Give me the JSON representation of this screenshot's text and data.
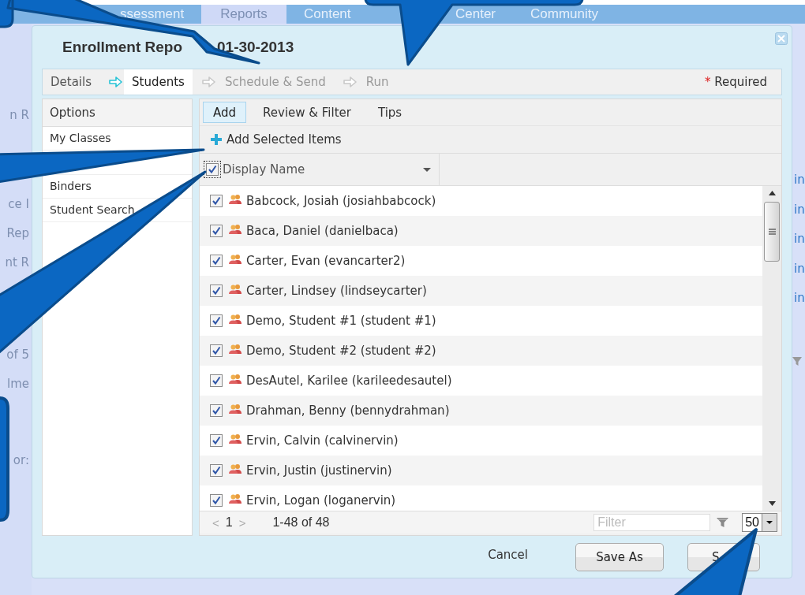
{
  "background": {
    "nav_tabs": [
      {
        "label": "ssessment",
        "selected": false
      },
      {
        "label": "Reports",
        "selected": true
      },
      {
        "label": "Content",
        "selected": false
      },
      {
        "label": "Center",
        "selected": false
      },
      {
        "label": "Community",
        "selected": false
      }
    ],
    "left_fragments": [
      "n R",
      "ce I",
      "Rep",
      "nt R",
      "of 5",
      "lme",
      "or:"
    ],
    "right_fragments": [
      "in",
      "in",
      "in",
      "in",
      "in"
    ]
  },
  "dialog": {
    "title_start": "Enrollment Repo",
    "title_end": "01-30-2013",
    "steps": [
      {
        "label": "Details",
        "selected": false,
        "disabled": false
      },
      {
        "label": "Students",
        "selected": true,
        "disabled": false
      },
      {
        "label": "Schedule & Send",
        "selected": false,
        "disabled": true
      },
      {
        "label": "Run",
        "selected": false,
        "disabled": true
      }
    ],
    "required_mark": "*",
    "required_note": "Required",
    "options": {
      "header": "Options",
      "items": [
        {
          "label": "My Classes"
        },
        {
          "label": "Binders"
        },
        {
          "label": "Student Search"
        }
      ]
    },
    "subtabs": [
      {
        "label": "Add",
        "selected": true
      },
      {
        "label": "Review & Filter",
        "selected": false
      },
      {
        "label": "Tips",
        "selected": false
      }
    ],
    "add_selected": "Add Selected Items",
    "column": {
      "label": "Display Name",
      "checked": true
    },
    "students": [
      {
        "name": "Babcock, Josiah (josiahbabcock)",
        "checked": true
      },
      {
        "name": "Baca, Daniel (danielbaca)",
        "checked": true
      },
      {
        "name": "Carter, Evan (evancarter2)",
        "checked": true
      },
      {
        "name": "Carter, Lindsey (lindseycarter)",
        "checked": true
      },
      {
        "name": "Demo, Student #1 (student #1)",
        "checked": true
      },
      {
        "name": "Demo, Student #2 (student #2)",
        "checked": true
      },
      {
        "name": "DesAutel, Karilee (karileedesautel)",
        "checked": true
      },
      {
        "name": "Drahman, Benny (bennydrahman)",
        "checked": true
      },
      {
        "name": "Ervin, Calvin (calvinervin)",
        "checked": true
      },
      {
        "name": "Ervin, Justin (justinervin)",
        "checked": true
      },
      {
        "name": "Ervin, Logan (loganervin)",
        "checked": true
      }
    ],
    "pager": {
      "prev": "<",
      "page": "1",
      "next": ">",
      "range": "1-48 of 48",
      "filter_placeholder": "Filter",
      "page_size": "50"
    },
    "buttons": [
      {
        "label": "Cancel",
        "kind": "link"
      },
      {
        "label": "Save As",
        "kind": "button"
      },
      {
        "label": "S",
        "kind": "button"
      }
    ]
  }
}
